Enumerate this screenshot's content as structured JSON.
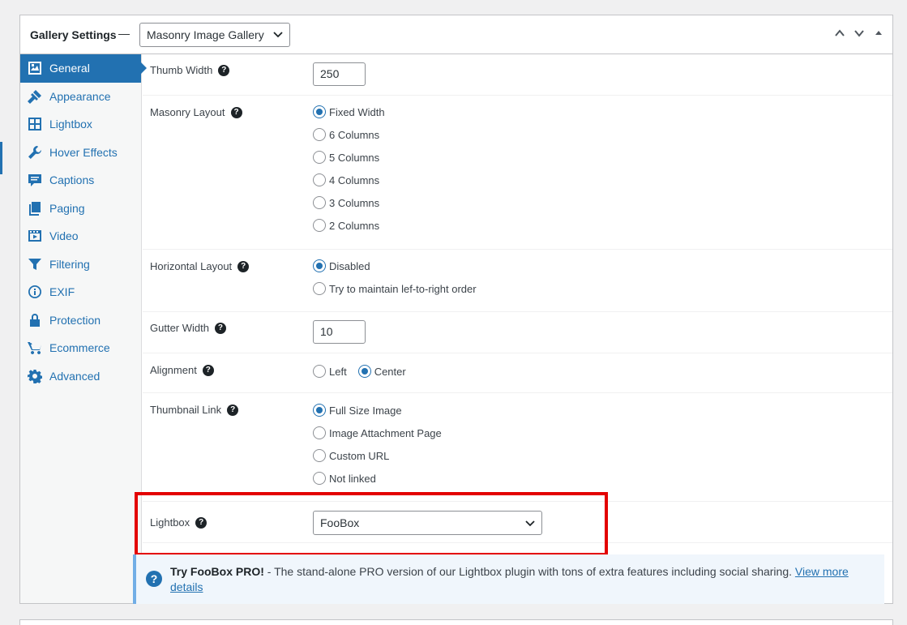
{
  "header": {
    "title": "Gallery Settings",
    "separator": "—",
    "gallery_type": "Masonry Image Gallery"
  },
  "sidebar": {
    "items": [
      {
        "label": "General",
        "icon": "general-icon"
      },
      {
        "label": "Appearance",
        "icon": "appearance-icon"
      },
      {
        "label": "Lightbox",
        "icon": "lightbox-icon"
      },
      {
        "label": "Hover Effects",
        "icon": "wrench-icon"
      },
      {
        "label": "Captions",
        "icon": "captions-icon"
      },
      {
        "label": "Paging",
        "icon": "paging-icon"
      },
      {
        "label": "Video",
        "icon": "video-icon"
      },
      {
        "label": "Filtering",
        "icon": "filter-icon"
      },
      {
        "label": "EXIF",
        "icon": "info-icon"
      },
      {
        "label": "Protection",
        "icon": "lock-icon"
      },
      {
        "label": "Ecommerce",
        "icon": "cart-icon"
      },
      {
        "label": "Advanced",
        "icon": "gear-icon"
      }
    ],
    "active_index": 0
  },
  "settings": {
    "thumb_width": {
      "label": "Thumb Width",
      "value": "250"
    },
    "masonry_layout": {
      "label": "Masonry Layout",
      "options": [
        "Fixed Width",
        "6 Columns",
        "5 Columns",
        "4 Columns",
        "3 Columns",
        "2 Columns"
      ],
      "selected": "Fixed Width"
    },
    "horizontal_layout": {
      "label": "Horizontal Layout",
      "options": [
        "Disabled",
        "Try to maintain lef-to-right order"
      ],
      "selected": "Disabled"
    },
    "gutter_width": {
      "label": "Gutter Width",
      "value": "10"
    },
    "alignment": {
      "label": "Alignment",
      "options": [
        "Left",
        "Center"
      ],
      "selected": "Center"
    },
    "thumbnail_link": {
      "label": "Thumbnail Link",
      "options": [
        "Full Size Image",
        "Image Attachment Page",
        "Custom URL",
        "Not linked"
      ],
      "selected": "Full Size Image"
    },
    "lightbox": {
      "label": "Lightbox",
      "value": "FooBox"
    }
  },
  "notice": {
    "strong": "Try FooBox PRO!",
    "text": " - The stand-alone PRO version of our Lightbox plugin with tons of extra features including social sharing. ",
    "link_part1": "View more",
    "link_part2": "details"
  },
  "colors": {
    "accent": "#2271b1",
    "highlight": "#e30000",
    "notice_bg": "#f0f6fc"
  }
}
